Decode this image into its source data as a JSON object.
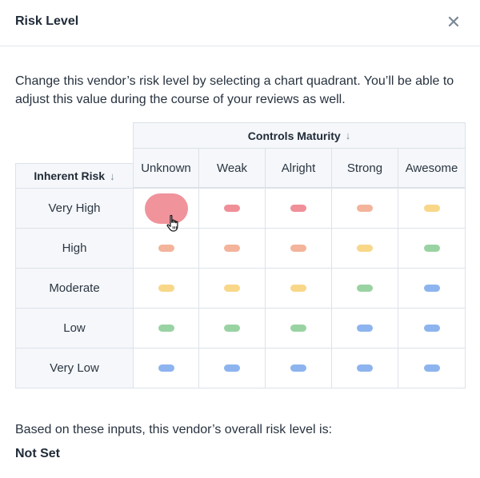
{
  "dialog": {
    "title": "Risk Level",
    "close_icon": "close-icon"
  },
  "description": "Change this vendor’s risk level by selecting a chart quadrant. You’ll be able to adjust this value during the course of your reviews as well.",
  "matrix": {
    "controls_header": "Controls Maturity",
    "inherent_header": "Inherent Risk",
    "sort_icon": "↓",
    "columns": [
      "Unknown",
      "Weak",
      "Alright",
      "Strong",
      "Awesome"
    ],
    "rows": [
      "Very High",
      "High",
      "Moderate",
      "Low",
      "Very Low"
    ],
    "cell_colors": [
      [
        "#f0939b",
        "#ef8f97",
        "#ef8f97",
        "#f3b49b",
        "#f8d789"
      ],
      [
        "#f3b49b",
        "#f3b49b",
        "#f3b49b",
        "#f8d789",
        "#9ad3a3"
      ],
      [
        "#f8d789",
        "#f8d789",
        "#f8d789",
        "#9ad3a3",
        "#8db4ef"
      ],
      [
        "#9ad3a3",
        "#9ad3a3",
        "#9ad3a3",
        "#8db4ef",
        "#8db4ef"
      ],
      [
        "#8db4ef",
        "#8db4ef",
        "#8db4ef",
        "#8db4ef",
        "#8db4ef"
      ]
    ],
    "hovered_cell": {
      "row": 0,
      "col": 0
    }
  },
  "result": {
    "label": "Based on these inputs, this vendor’s overall risk level is:",
    "value": "Not Set"
  }
}
